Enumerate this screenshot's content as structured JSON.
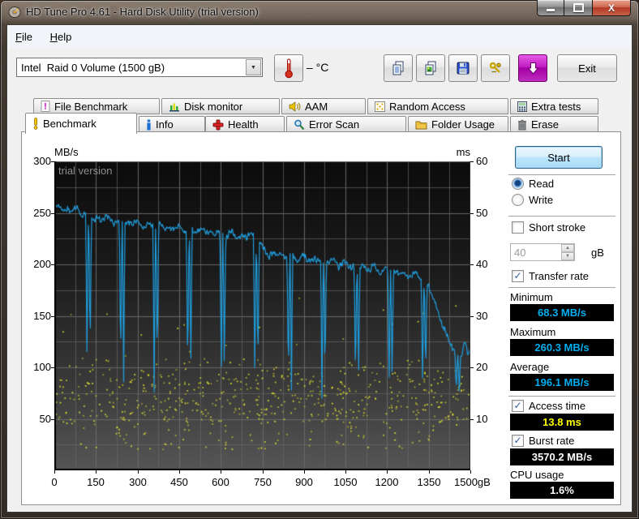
{
  "window": {
    "title": "HD Tune Pro 4.61 - Hard Disk Utility (trial version)",
    "controls": [
      "minimize",
      "maximize",
      "close"
    ]
  },
  "menu": {
    "items": [
      "File",
      "Help"
    ]
  },
  "toolbar": {
    "drive": "Intel  Raid 0 Volume (1500 gB)",
    "temp_label": "– °C",
    "buttons": [
      "thermometer",
      "copy-text",
      "copy-image",
      "save",
      "options",
      "download"
    ],
    "exit_label": "Exit"
  },
  "tabs": {
    "active": "Benchmark",
    "row1": [
      {
        "label": "File Benchmark",
        "icon": "exclaim-pink-icon"
      },
      {
        "label": "Disk monitor",
        "icon": "bar-chart-icon"
      },
      {
        "label": "AAM",
        "icon": "speaker-icon"
      },
      {
        "label": "Random Access",
        "icon": "dice-icon"
      },
      {
        "label": "Extra tests",
        "icon": "calculator-icon"
      }
    ],
    "row2": [
      {
        "label": "Benchmark",
        "icon": "exclaim-yellow-icon"
      },
      {
        "label": "Info",
        "icon": "info-icon"
      },
      {
        "label": "Health",
        "icon": "health-cross-icon"
      },
      {
        "label": "Error Scan",
        "icon": "magnifier-icon"
      },
      {
        "label": "Folder Usage",
        "icon": "folder-icon"
      },
      {
        "label": "Erase",
        "icon": "trash-icon"
      }
    ]
  },
  "chart_data": {
    "type": "line",
    "watermark": "trial version",
    "left_axis": {
      "label": "MB/s",
      "min": 0,
      "max": 300,
      "ticks": [
        300,
        250,
        200,
        150,
        100,
        50
      ]
    },
    "right_axis": {
      "label": "ms",
      "min": 0,
      "max": 60,
      "ticks": [
        60,
        50,
        40,
        30,
        20,
        10
      ]
    },
    "x_axis": {
      "min": 0,
      "max": 1500,
      "unit": "gB",
      "ticks": [
        "0",
        "150",
        "300",
        "450",
        "600",
        "750",
        "900",
        "1050",
        "1200",
        "1350",
        "1500gB"
      ]
    },
    "grid": {
      "x_minor_step_gb": 75,
      "y_minor_step_mbs": 25,
      "on": true
    },
    "plot_bg_gradient": [
      "#0c0c0c",
      "#1b1b1b",
      "#3a3a3a",
      "#565656"
    ],
    "grid_color": "#6a6a6a",
    "series": [
      {
        "name": "transfer-rate",
        "type": "line",
        "color": "#1F9EDE",
        "unit": "MB/s",
        "stats": {
          "minimum": 68.3,
          "maximum": 260.3,
          "average": 196.1
        },
        "baseline_keypoints": [
          [
            0,
            253
          ],
          [
            20,
            257
          ],
          [
            45,
            251
          ],
          [
            70,
            255
          ],
          [
            95,
            249
          ],
          [
            115,
            251
          ],
          [
            140,
            245
          ],
          [
            165,
            242
          ],
          [
            190,
            246
          ],
          [
            215,
            240
          ],
          [
            240,
            243
          ],
          [
            265,
            238
          ],
          [
            290,
            242
          ],
          [
            315,
            236
          ],
          [
            340,
            240
          ],
          [
            365,
            236
          ],
          [
            390,
            238
          ],
          [
            415,
            233
          ],
          [
            440,
            237
          ],
          [
            465,
            232
          ],
          [
            490,
            235
          ],
          [
            515,
            231
          ],
          [
            540,
            234
          ],
          [
            565,
            229
          ],
          [
            590,
            232
          ],
          [
            615,
            228
          ],
          [
            640,
            231
          ],
          [
            665,
            226
          ],
          [
            690,
            228
          ],
          [
            715,
            229
          ],
          [
            735,
            224
          ],
          [
            755,
            215
          ],
          [
            775,
            208
          ],
          [
            800,
            212
          ],
          [
            825,
            206
          ],
          [
            850,
            210
          ],
          [
            875,
            204
          ],
          [
            900,
            208
          ],
          [
            925,
            203
          ],
          [
            950,
            206
          ],
          [
            975,
            201
          ],
          [
            1000,
            204
          ],
          [
            1025,
            199
          ],
          [
            1050,
            202
          ],
          [
            1075,
            197
          ],
          [
            1100,
            200
          ],
          [
            1125,
            195
          ],
          [
            1150,
            198
          ],
          [
            1175,
            193
          ],
          [
            1200,
            196
          ],
          [
            1225,
            191
          ],
          [
            1250,
            193
          ],
          [
            1275,
            188
          ],
          [
            1300,
            190
          ],
          [
            1315,
            188
          ],
          [
            1338,
            184
          ],
          [
            1355,
            176
          ],
          [
            1372,
            162
          ],
          [
            1388,
            150
          ],
          [
            1402,
            140
          ],
          [
            1415,
            130
          ],
          [
            1428,
            124
          ],
          [
            1440,
            118
          ],
          [
            1452,
            112
          ],
          [
            1462,
            108
          ],
          [
            1472,
            118
          ],
          [
            1482,
            124
          ],
          [
            1490,
            112
          ],
          [
            1500,
            117
          ]
        ],
        "dips": {
          "positions": [
            123,
            244,
            365,
            486,
            607,
            728,
            849,
            970,
            1091,
            1212,
            1333,
            1454
          ],
          "depths": [
            85,
            79,
            76,
            74,
            73,
            72,
            71,
            70,
            69,
            68.3,
            69,
            70
          ],
          "shape": "double-spike"
        }
      },
      {
        "name": "access-time",
        "type": "scatter",
        "color": "#E9E92F",
        "unit": "ms",
        "average_ms": 13.8,
        "count": 640,
        "band_ms": [
          4,
          22
        ],
        "dense_band_ms": [
          9,
          19
        ],
        "outlier_max_ms": 36,
        "seed": 1337
      }
    ]
  },
  "panel": {
    "start_label": "Start",
    "mode": {
      "read": "Read",
      "write": "Write",
      "selected": "Read"
    },
    "short_stroke": {
      "label": "Short stroke",
      "checked": false,
      "value": "40",
      "unit": "gB"
    },
    "transfer_rate": {
      "label": "Transfer rate",
      "checked": true,
      "minimum_label": "Minimum",
      "minimum": "68.3 MB/s",
      "maximum_label": "Maximum",
      "maximum": "260.3 MB/s",
      "average_label": "Average",
      "average": "196.1 MB/s",
      "value_color": "#00AEEF"
    },
    "access_time": {
      "label": "Access time",
      "checked": true,
      "value": "13.8 ms",
      "value_color": "#FFFF00"
    },
    "burst_rate": {
      "label": "Burst rate",
      "checked": true,
      "value": "3570.2 MB/s",
      "value_color": "#FFFFFF"
    },
    "cpu_usage": {
      "label": "CPU usage",
      "value": "1.6%",
      "value_color": "#FFFFFF"
    }
  }
}
